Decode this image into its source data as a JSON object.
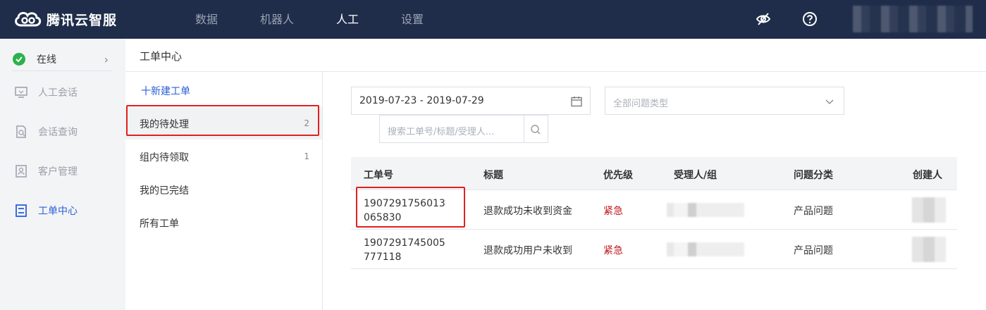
{
  "app": {
    "brand": "腾讯云智服"
  },
  "nav": {
    "items": [
      {
        "label": "数据"
      },
      {
        "label": "机器人"
      },
      {
        "label": "人工"
      },
      {
        "label": "设置"
      }
    ],
    "active": "人工"
  },
  "sidebar": {
    "status": "在线",
    "items": [
      {
        "label": "人工会话"
      },
      {
        "label": "会话查询"
      },
      {
        "label": "客户管理"
      },
      {
        "label": "工单中心"
      }
    ]
  },
  "page": {
    "title": "工单中心"
  },
  "ticket_nav": {
    "new_ticket": "十新建工单",
    "items": [
      {
        "label": "我的待处理",
        "count": "2"
      },
      {
        "label": "组内待领取",
        "count": "1"
      },
      {
        "label": "我的已完结",
        "count": ""
      },
      {
        "label": "所有工单",
        "count": ""
      }
    ]
  },
  "filters": {
    "date_range": "2019-07-23 - 2019-07-29",
    "type_placeholder": "全部问题类型",
    "search_placeholder": "搜索工单号/标题/受理人..."
  },
  "table": {
    "headers": [
      "工单号",
      "标题",
      "优先级",
      "受理人/组",
      "问题分类",
      "创建人"
    ],
    "rows": [
      {
        "id": "1907291756013065830",
        "title": "退款成功未收到资金",
        "priority": "紧急",
        "category": "产品问题"
      },
      {
        "id": "1907291745005777118",
        "title": "退款成功用户未收到",
        "priority": "紧急",
        "category": "产品问题"
      }
    ]
  },
  "colors": {
    "topbar": "#1f2d4a",
    "accent": "#2c5fd9",
    "urgent": "#c0191e",
    "online": "#2bb24c",
    "highlight": "#e02020"
  }
}
